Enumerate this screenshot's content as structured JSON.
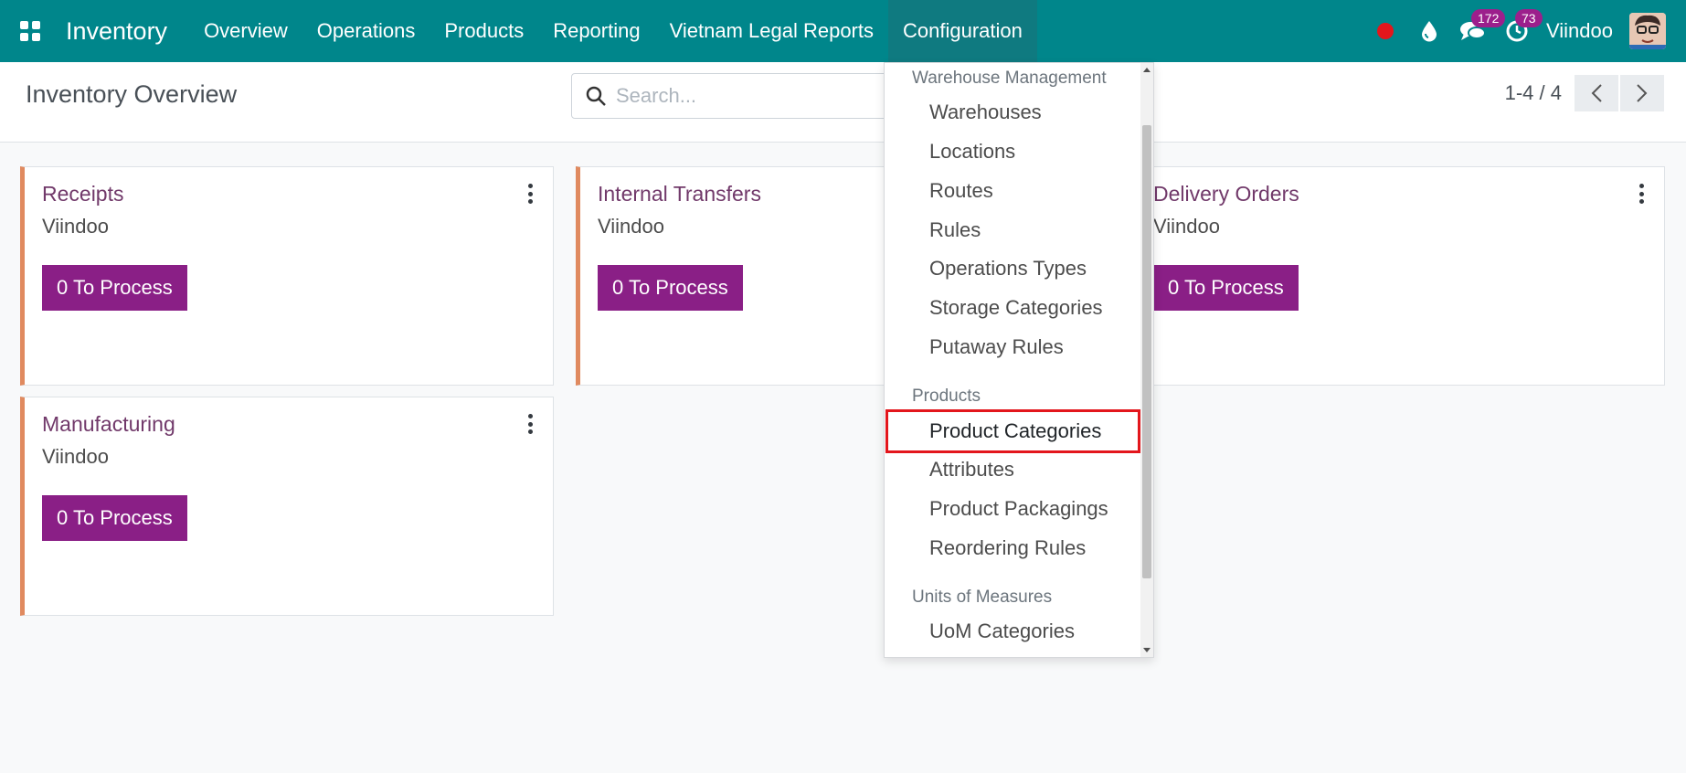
{
  "navbar": {
    "app_name": "Inventory",
    "menu": [
      "Overview",
      "Operations",
      "Products",
      "Reporting",
      "Vietnam Legal Reports",
      "Configuration"
    ],
    "active_menu": "Configuration",
    "messages_count": "172",
    "activities_count": "73",
    "user_name": "Viindoo",
    "colors": {
      "bar": "#00868b",
      "badge": "#9c1f8c",
      "record": "#e3161c"
    }
  },
  "control_panel": {
    "title": "Inventory Overview",
    "search_placeholder": "Search...",
    "pager": "1-4 / 4"
  },
  "cards": [
    {
      "title": "Receipts",
      "company": "Viindoo",
      "button": "0 To Process"
    },
    {
      "title": "Internal Transfers",
      "company": "Viindoo",
      "button": "0 To Process"
    },
    {
      "title": "Delivery Orders",
      "company": "Viindoo",
      "button": "0 To Process"
    },
    {
      "title": "Manufacturing",
      "company": "Viindoo",
      "button": "0 To Process"
    }
  ],
  "config_dropdown": {
    "sections": [
      {
        "header": "Warehouse Management",
        "items": [
          "Warehouses",
          "Locations",
          "Routes",
          "Rules",
          "Operations Types",
          "Storage Categories",
          "Putaway Rules"
        ]
      },
      {
        "header": "Products",
        "items": [
          "Product Categories",
          "Attributes",
          "Product Packagings",
          "Reordering Rules"
        ]
      },
      {
        "header": "Units of Measures",
        "items": [
          "UoM Categories"
        ]
      }
    ],
    "highlighted_item": "Product Categories"
  }
}
